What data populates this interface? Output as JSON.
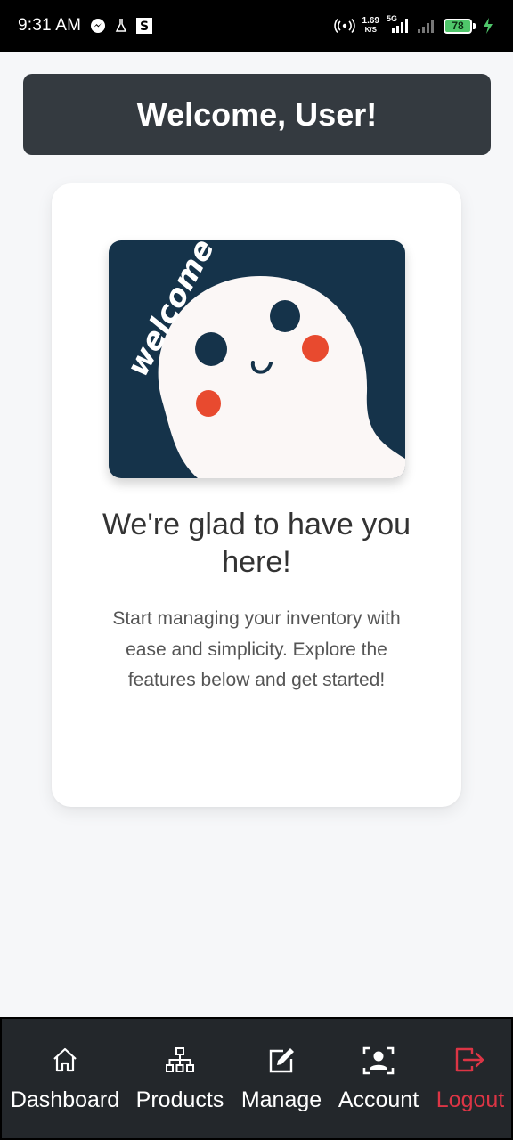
{
  "status_bar": {
    "time": "9:31 AM",
    "speed_value": "1.69",
    "speed_unit": "K/S",
    "network": "5G",
    "battery": "78",
    "icons": [
      "messenger-icon",
      "lab-flask-icon",
      "s-app-icon",
      "hotspot-icon",
      "signal-icon",
      "charging-icon"
    ]
  },
  "header": {
    "title": "Welcome, User!"
  },
  "card": {
    "image_text": "welcome",
    "heading": "We're glad to have you here!",
    "description": "Start managing your inventory with ease and simplicity. Explore the features below and get started!"
  },
  "bottom_nav": {
    "items": [
      {
        "label": "Dashboard",
        "icon": "home-icon"
      },
      {
        "label": "Products",
        "icon": "sitemap-icon"
      },
      {
        "label": "Manage",
        "icon": "edit-icon"
      },
      {
        "label": "Account",
        "icon": "user-badge-icon"
      },
      {
        "label": "Logout",
        "icon": "logout-icon"
      }
    ]
  },
  "colors": {
    "header_bg": "#343a40",
    "nav_bg": "#23272b",
    "logout": "#dc3545",
    "image_bg": "#15334a",
    "cheek": "#e84a2f"
  }
}
